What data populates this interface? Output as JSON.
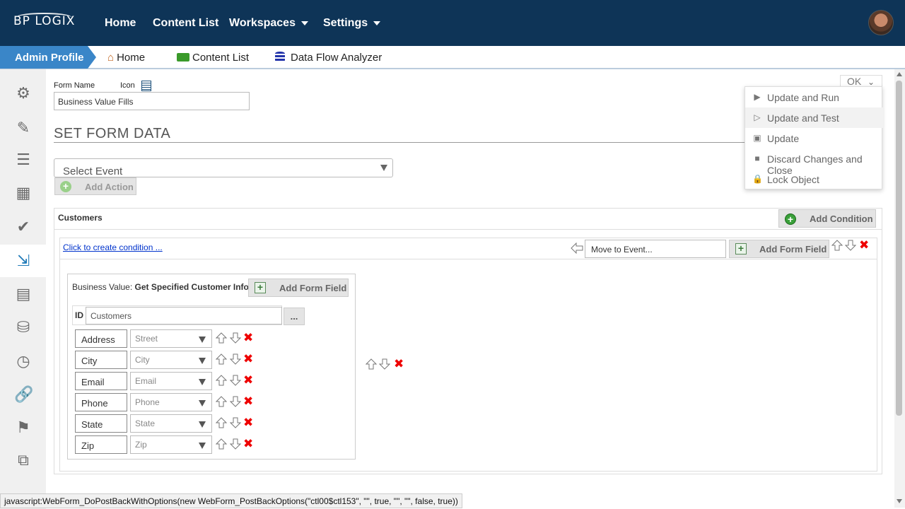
{
  "header": {
    "logo": "BP LOGIX",
    "nav": [
      {
        "label": "Home"
      },
      {
        "label": "Content List"
      },
      {
        "label": "Workspaces"
      },
      {
        "label": "Settings"
      }
    ]
  },
  "subnav": {
    "breadcrumb": "Admin Profile",
    "links": [
      {
        "label": "Home"
      },
      {
        "label": "Content List"
      },
      {
        "label": "Data Flow Analyzer"
      }
    ]
  },
  "form": {
    "name_label": "Form Name",
    "icon_label": "Icon",
    "name_value": "Business Value Fills",
    "heading": "SET FORM DATA",
    "event_placeholder": "Select Event",
    "add_action": "Add Action"
  },
  "customers": {
    "title": "Customers",
    "add_condition": "Add Condition",
    "create_condition_link": "Click to create condition ...",
    "move_placeholder": "Move to Event...",
    "add_form_field": "Add Form Field"
  },
  "business_value": {
    "prefix": "Business Value:",
    "name": "Get Specified Customer Info",
    "add_form_field": "Add Form Field",
    "id_label": "ID",
    "id_value": "Customers",
    "ellipsis": "...",
    "fields": [
      {
        "label": "Address",
        "value": "Street"
      },
      {
        "label": "City",
        "value": "City"
      },
      {
        "label": "Email",
        "value": "Email"
      },
      {
        "label": "Phone",
        "value": "Phone"
      },
      {
        "label": "State",
        "value": "State"
      },
      {
        "label": "Zip",
        "value": "Zip"
      }
    ]
  },
  "ok_menu": {
    "ok_label": "OK",
    "items": [
      {
        "label": "Update and Run",
        "icon": "play-icon"
      },
      {
        "label": "Update and Test",
        "icon": "play-circle-icon"
      },
      {
        "label": "Update",
        "icon": "save-icon"
      },
      {
        "label": "Discard Changes and Close",
        "icon": "stop-icon"
      },
      {
        "label": "Lock Object",
        "icon": "lock-icon"
      }
    ]
  },
  "status_bar": "javascript:WebForm_DoPostBackWithOptions(new WebForm_PostBackOptions(\"ctl00$ctl153\", \"\", true, \"\", \"\", false, true))",
  "colors": {
    "topbar": "#0e3457",
    "breadcrumb": "#3a86c8",
    "sidebar": "#f0f0f0",
    "delete": "#ee0000"
  }
}
